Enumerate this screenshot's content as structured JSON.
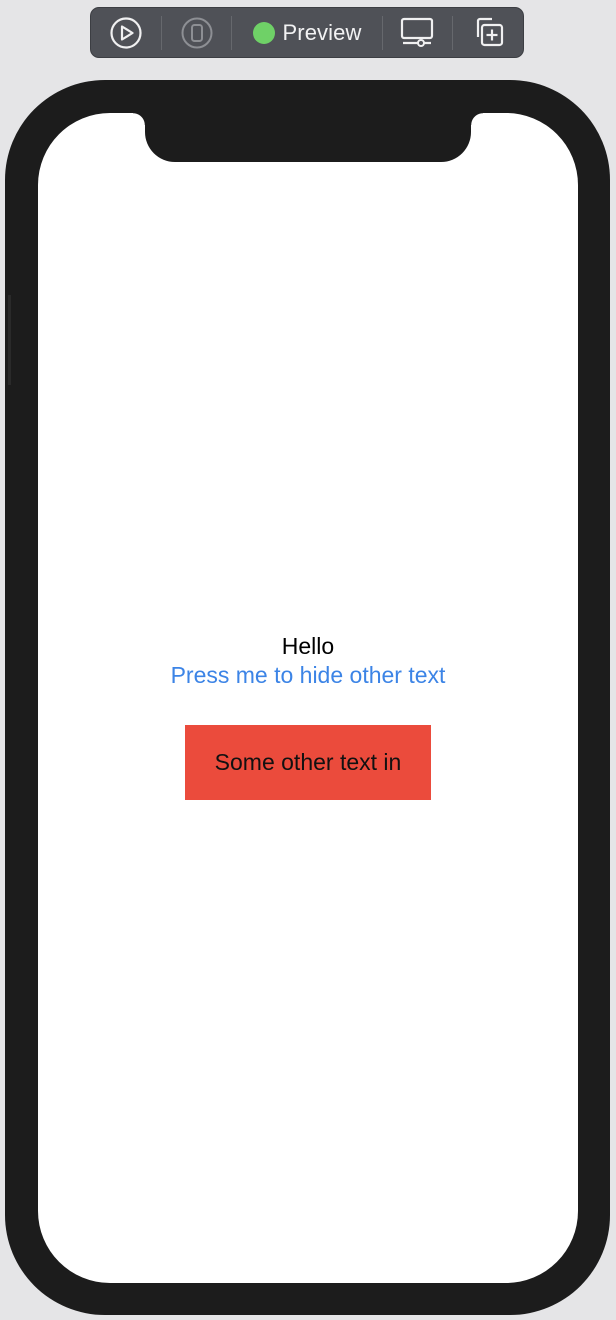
{
  "toolbar": {
    "buttons": [
      {
        "name": "live-preview",
        "icon": "play-circle-icon"
      },
      {
        "name": "device-preview",
        "icon": "phone-outline-icon"
      },
      {
        "name": "inspect-preview",
        "icon": "monitor-settings-icon"
      },
      {
        "name": "duplicate-preview",
        "icon": "duplicate-plus-icon"
      }
    ],
    "status_color": "#6fd167",
    "preview_label": "Preview"
  },
  "screen": {
    "hello_text": "Hello",
    "hide_button_label": "Press me to hide other text",
    "other_text": "Some other text in",
    "colors": {
      "link": "#3c84e6",
      "red_box": "#eb4b3c",
      "background": "#ffffff"
    }
  }
}
